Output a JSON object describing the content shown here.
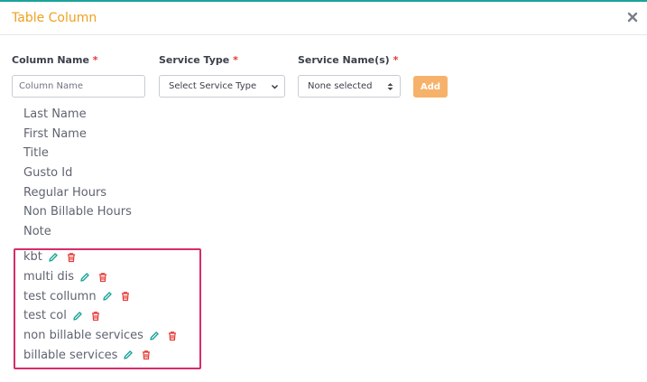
{
  "dialog": {
    "title": "Table Column",
    "close_icon": "close-icon"
  },
  "form": {
    "column_name": {
      "label": "Column Name",
      "placeholder": "Column Name",
      "value": ""
    },
    "service_type": {
      "label": "Service Type",
      "selected": "Select Service Type"
    },
    "service_names": {
      "label": "Service Name(s)",
      "selected": "None selected"
    },
    "required_marker": "*",
    "add_label": "Add"
  },
  "columns": [
    "Last Name",
    "First Name",
    "Title",
    "Gusto Id",
    "Regular Hours",
    "Non Billable Hours",
    "Note"
  ],
  "custom_columns": [
    "kbt",
    "multi dis",
    "test collumn",
    "test col",
    "non billable services",
    "billable services"
  ],
  "icons": {
    "edit": "pencil-icon",
    "delete": "trash-icon"
  },
  "colors": {
    "title": "#f0a020",
    "top_border": "#1aa39a",
    "add_button": "#f6b26b",
    "required": "#e53935",
    "edit_icon": "#1aa39a",
    "delete_icon": "#e53935",
    "highlight_border": "#d62c6a"
  }
}
